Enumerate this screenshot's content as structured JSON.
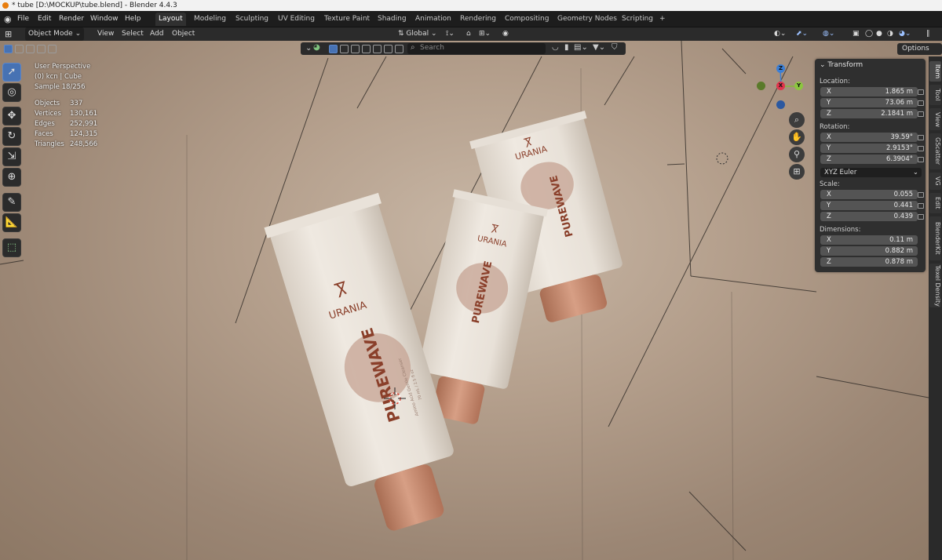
{
  "window": {
    "title": "* tube [D:\\MOCKUP\\tube.blend] - Blender 4.4.3"
  },
  "menu": {
    "items": [
      "File",
      "Edit",
      "Render",
      "Window",
      "Help"
    ]
  },
  "workspaces": [
    "Layout",
    "Modeling",
    "Sculpting",
    "UV Editing",
    "Texture Paint",
    "Shading",
    "Animation",
    "Rendering",
    "Compositing",
    "Geometry Nodes",
    "Scripting",
    "+"
  ],
  "header": {
    "mode": "Object Mode",
    "menus": [
      "View",
      "Select",
      "Add",
      "Object"
    ],
    "orientation": "Global"
  },
  "subheader": {
    "search_placeholder": "Search",
    "options": "Options"
  },
  "overlay": {
    "perspective": "User Perspective",
    "collection": "(0) kcn | Cube",
    "sample": "Sample 18/256",
    "stats": [
      {
        "label": "Objects",
        "value": "337"
      },
      {
        "label": "Vertices",
        "value": "130,161"
      },
      {
        "label": "Edges",
        "value": "252,991"
      },
      {
        "label": "Faces",
        "value": "124,315"
      },
      {
        "label": "Triangles",
        "value": "248,566"
      }
    ]
  },
  "transform": {
    "title": "Transform",
    "location_label": "Location:",
    "location": [
      {
        "axis": "X",
        "value": "1.865 m"
      },
      {
        "axis": "Y",
        "value": "73.06 m"
      },
      {
        "axis": "Z",
        "value": "2.1841 m"
      }
    ],
    "rotation_label": "Rotation:",
    "rotation": [
      {
        "axis": "X",
        "value": "39.59°"
      },
      {
        "axis": "Y",
        "value": "2.9153°"
      },
      {
        "axis": "Z",
        "value": "6.3904°"
      }
    ],
    "rotation_mode": "XYZ Euler",
    "scale_label": "Scale:",
    "scale": [
      {
        "axis": "X",
        "value": "0.055"
      },
      {
        "axis": "Y",
        "value": "0.441"
      },
      {
        "axis": "Z",
        "value": "0.439"
      }
    ],
    "dimensions_label": "Dimensions:",
    "dimensions": [
      {
        "axis": "X",
        "value": "0.11 m"
      },
      {
        "axis": "Y",
        "value": "0.882 m"
      },
      {
        "axis": "Z",
        "value": "0.878 m"
      }
    ]
  },
  "sidebar_tabs": [
    "Item",
    "Tool",
    "View",
    "GScatter",
    "VG",
    "Edit",
    "BlenderKit",
    "Texel Density"
  ],
  "gizmo": {
    "x": "X",
    "y": "Y",
    "z": "Z"
  },
  "product": {
    "brand": "URANIA",
    "name": "PUREWAVE",
    "small_text": "Amino Acid Gentle Cleanser",
    "volume": "70 mL / 2.5 fl oz"
  },
  "colors": {
    "accent": "#4772b3",
    "panel": "#2f2f2f",
    "header": "#2b2b2b",
    "tube_body": "#ece6dd",
    "tube_cap": "#c98d71",
    "label": "#8a3f2a"
  }
}
